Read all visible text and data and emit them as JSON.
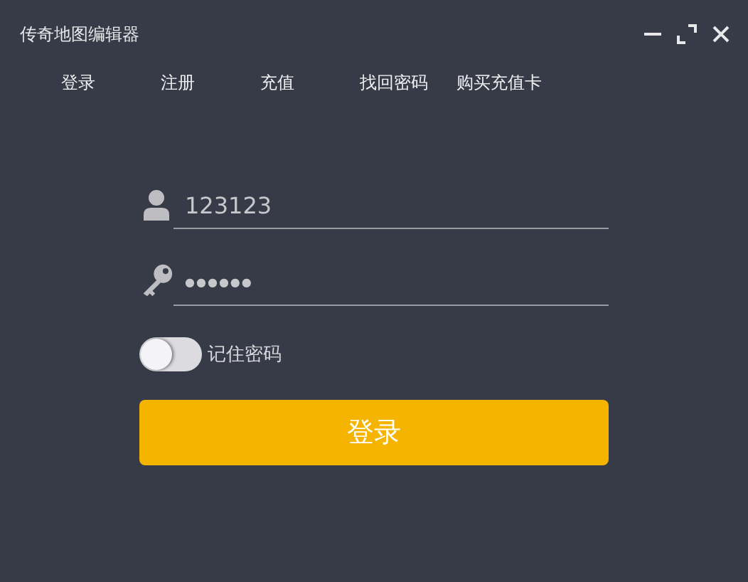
{
  "window": {
    "title": "传奇地图编辑器"
  },
  "nav": [
    {
      "label": "登录"
    },
    {
      "label": "注册"
    },
    {
      "label": "充值"
    },
    {
      "label": "找回密码"
    },
    {
      "label": "购买充值卡"
    }
  ],
  "username": {
    "value": "123123"
  },
  "password": {
    "value": "●●●●●●"
  },
  "remember": {
    "label": "记住密码",
    "on": false
  },
  "submit": {
    "label": "登录"
  }
}
